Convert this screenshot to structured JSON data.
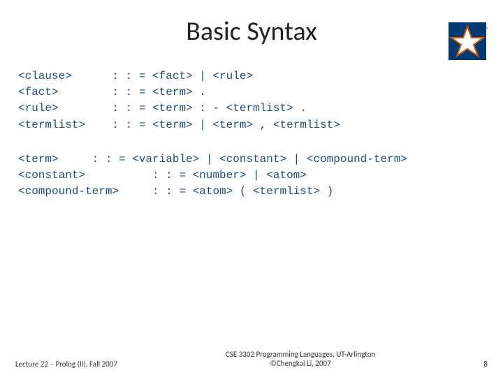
{
  "title": "Basic Syntax",
  "logo": {
    "name": "uta-star-logo"
  },
  "grammar": {
    "block1": "<clause>      : : = <fact> | <rule>\n<fact>        : : = <term> .\n<rule>        : : = <term> : - <termlist> .\n<termlist>    : : = <term> | <term> , <termlist>",
    "block2": "<term>     : : = <variable> | <constant> | <compound-term>\n<constant>          : : = <number> | <atom>\n<compound-term>     : : = <atom> ( <termlist> )"
  },
  "footer": {
    "left": "Lecture 22 – Prolog (II), Fall 2007",
    "center_line1": "CSE 3302 Programming Languages, UT-Arlington",
    "center_line2": "©Chengkai Li, 2007",
    "page": "8"
  }
}
